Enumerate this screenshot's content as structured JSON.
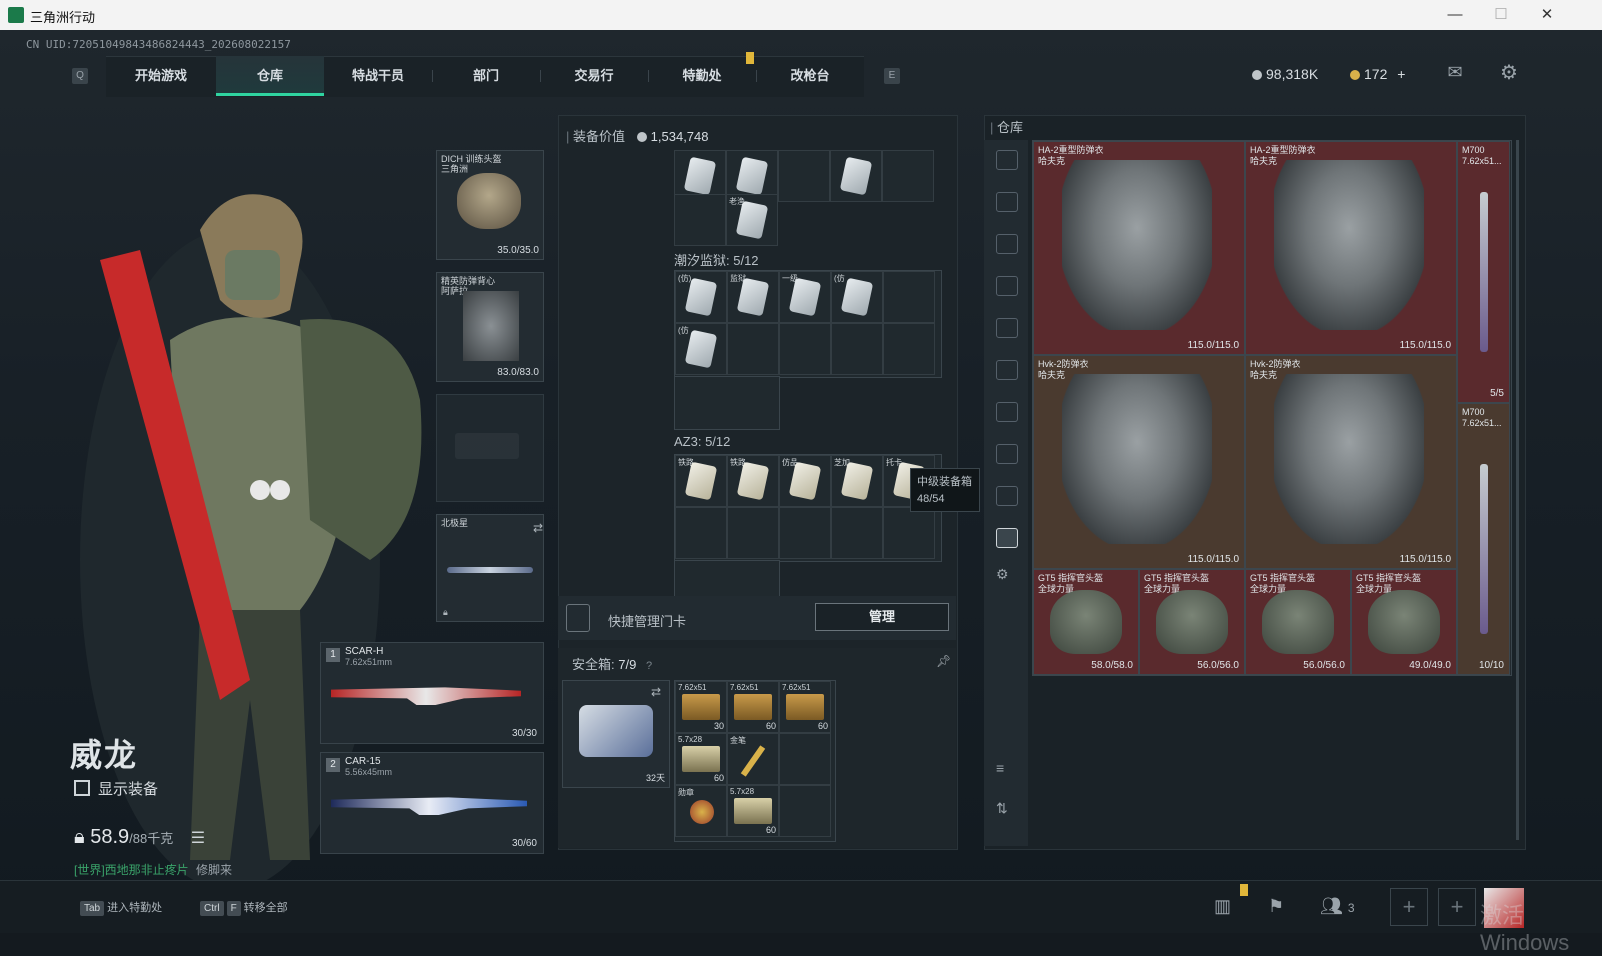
{
  "window": {
    "title": "三角洲行动",
    "minimize": "—",
    "maximize": "☐",
    "close": "✕"
  },
  "uid": "CN UID:72051049843486824443_202608022157",
  "nav": {
    "left_key": "Q",
    "right_key": "E",
    "tabs": [
      {
        "label": "开始游戏"
      },
      {
        "label": "仓库"
      },
      {
        "label": "特战干员"
      },
      {
        "label": "部门"
      },
      {
        "label": "交易行"
      },
      {
        "label": "特勤处"
      },
      {
        "label": "改枪台"
      }
    ]
  },
  "currency": {
    "silver": "98,318K",
    "gold": "172",
    "gold_add": "+"
  },
  "operator": {
    "name": "威龙",
    "show_equipment": "显示装备",
    "weight": "58.9",
    "weight_max": "/88千克"
  },
  "chat": {
    "channel": "[世界]",
    "message": "西地那非止疼片",
    "user": "修脚来"
  },
  "gear": {
    "helmet": {
      "name": "DICH 训练头盔",
      "sub": "三角洲",
      "durability": "35.0/35.0"
    },
    "armor": {
      "name": "精英防弹背心",
      "sub": "阿萨拉",
      "durability": "83.0/83.0"
    },
    "melee": {
      "name": "北极星"
    },
    "primary": {
      "slot": "1",
      "name": "SCAR-H",
      "caliber": "7.62x51mm",
      "ammo": "30/30"
    },
    "secondary": {
      "slot": "2",
      "name": "CAR-15",
      "caliber": "5.56x45mm",
      "ammo": "30/60"
    }
  },
  "equipment": {
    "title": "装备价值",
    "value": "1,534,748",
    "bag1_label": "老渔",
    "container1": {
      "title": "潮汐监狱: 5/12",
      "items": [
        "(仿)",
        "监狱",
        "一级",
        "(仿",
        "(仿"
      ]
    },
    "container2": {
      "title": "AZ3: 5/12",
      "items": [
        "铁路",
        "铁路",
        "仿品",
        "芝加",
        "托卡"
      ]
    },
    "tooltip": {
      "name": "中级装备箱",
      "count": "48/54"
    },
    "keycard_label": "快捷管理门卡",
    "manage_button": "管理",
    "safebox": {
      "title": "安全箱:",
      "count": "7/9",
      "help": "?",
      "days": "32天",
      "items": [
        {
          "label": "7.62x51",
          "qty": "30"
        },
        {
          "label": "7.62x51",
          "qty": "60"
        },
        {
          "label": "7.62x51",
          "qty": "60"
        },
        {
          "label": "5.7x28",
          "qty": "60"
        },
        {
          "label": "金笔",
          "qty": ""
        },
        {
          "label": "勋章",
          "qty": ""
        },
        {
          "label": "5.7x28",
          "qty": "60"
        }
      ]
    }
  },
  "stash": {
    "title": "仓库",
    "items": [
      {
        "name": "HA-2重型防弹衣",
        "sub": "哈夫克",
        "durability": "115.0/115.0"
      },
      {
        "name": "HA-2重型防弹衣",
        "sub": "哈夫克",
        "durability": "115.0/115.0"
      },
      {
        "name": "Hvk-2防弹衣",
        "sub": "哈夫克",
        "durability": "115.0/115.0"
      },
      {
        "name": "Hvk-2防弹衣",
        "sub": "哈夫克",
        "durability": "115.0/115.0"
      },
      {
        "name": "GT5 指挥官头盔",
        "sub": "全球力量",
        "durability": "58.0/58.0"
      },
      {
        "name": "GT5 指挥官头盔",
        "sub": "全球力量",
        "durability": "56.0/56.0"
      },
      {
        "name": "GT5 指挥官头盔",
        "sub": "全球力量",
        "durability": "56.0/56.0"
      },
      {
        "name": "GT5 指挥官头盔",
        "sub": "全球力量",
        "durability": "49.0/49.0"
      }
    ],
    "rifles": [
      {
        "name": "M700",
        "cal": "7.62x51...",
        "count": "5/5"
      },
      {
        "name": "M700",
        "cal": "7.62x51...",
        "count": "10/10"
      }
    ]
  },
  "bottom": {
    "hint1_key": "Tab",
    "hint1": "进入特勤处",
    "hint2_key1": "Ctrl",
    "hint2_key2": "F",
    "hint2": "转移全部",
    "squad_count": "3",
    "watermark": "激活 Windows"
  }
}
